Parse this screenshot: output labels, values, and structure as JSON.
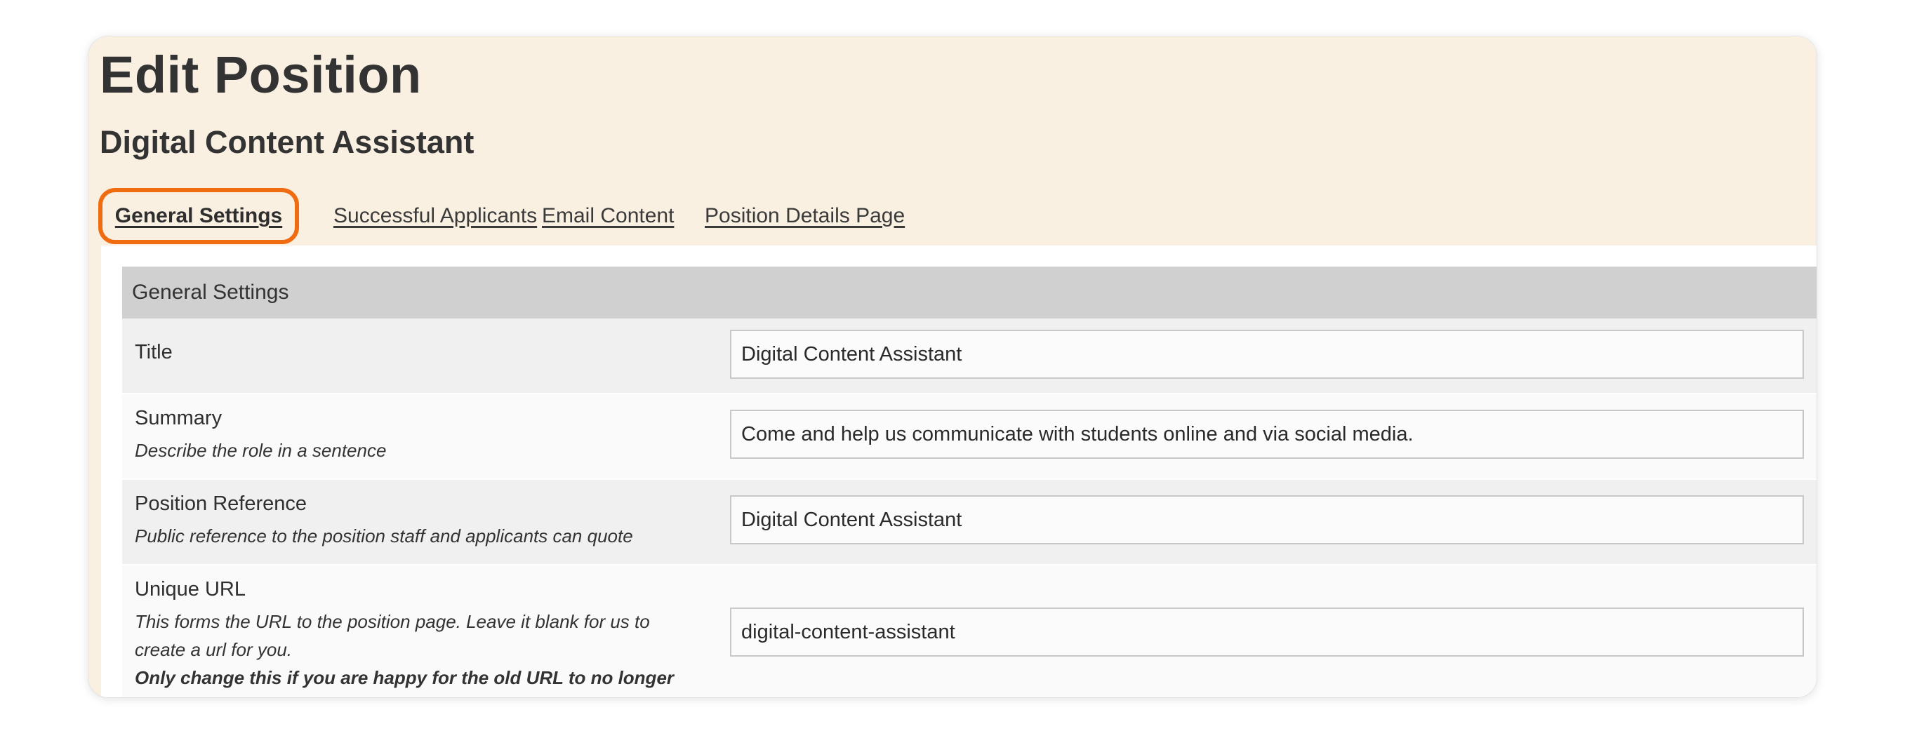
{
  "page": {
    "title": "Edit Position",
    "subtitle": "Digital Content Assistant"
  },
  "tabs": [
    {
      "label": "General Settings",
      "active": true
    },
    {
      "label": "Successful Applicants",
      "active": false
    },
    {
      "label": "Email Content",
      "active": false
    },
    {
      "label": "Position Details Page",
      "active": false
    }
  ],
  "section": {
    "header": "General Settings",
    "fields": [
      {
        "label": "Title",
        "value": "Digital Content Assistant"
      },
      {
        "label": "Summary",
        "help": "Describe the role in a sentence",
        "value": "Come and help us communicate with students online and via social media."
      },
      {
        "label": "Position Reference",
        "help": "Public reference to the position staff and applicants can quote",
        "value": "Digital Content Assistant"
      },
      {
        "label": "Unique URL",
        "help_line1": "This forms the URL to the position page. Leave it blank for us to",
        "help_line2": "create a url for you.",
        "help_warning": "Only change this if you are happy for the old URL to no longer work.",
        "value": "digital-content-assistant"
      }
    ]
  },
  "colors": {
    "header_background": "#faf0e2",
    "active_tab_outline": "#ef6d10",
    "section_header_background": "#d0d0d0"
  }
}
